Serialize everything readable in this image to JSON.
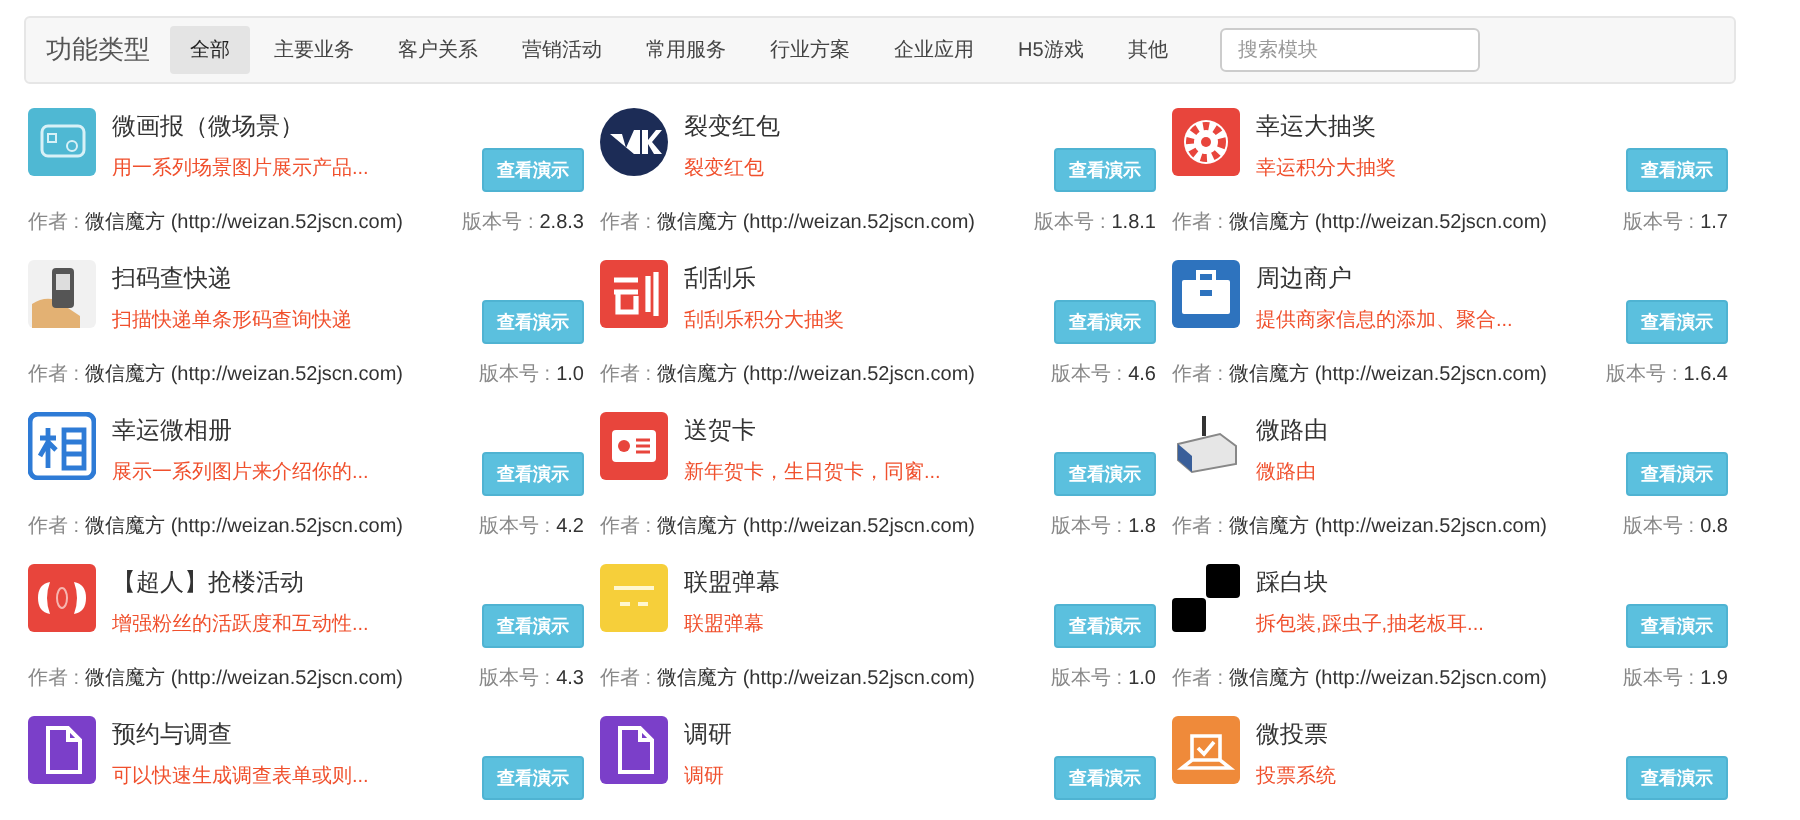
{
  "filter_bar": {
    "label": "功能类型",
    "tabs": [
      {
        "label": "全部",
        "selected": true
      },
      {
        "label": "主要业务",
        "selected": false
      },
      {
        "label": "客户关系",
        "selected": false
      },
      {
        "label": "营销活动",
        "selected": false
      },
      {
        "label": "常用服务",
        "selected": false
      },
      {
        "label": "行业方案",
        "selected": false
      },
      {
        "label": "企业应用",
        "selected": false
      },
      {
        "label": "H5游戏",
        "selected": false
      },
      {
        "label": "其他",
        "selected": false
      }
    ],
    "search": {
      "placeholder": "搜索模块"
    }
  },
  "modules": [
    {
      "title": "微画报（微场景）",
      "description": "用一系列场景图片展示产品...",
      "button": "查看演示",
      "author_label": "作者 :",
      "author": "微信魔方 (http://weizan.52jscn.com)",
      "version_label": "版本号 :",
      "version": "2.8.3"
    },
    {
      "title": "裂变红包",
      "description": "裂变红包",
      "button": "查看演示",
      "author_label": "作者 :",
      "author": "微信魔方 (http://weizan.52jscn.com)",
      "version_label": "版本号 :",
      "version": "1.8.1"
    },
    {
      "title": "幸运大抽奖",
      "description": "幸运积分大抽奖",
      "button": "查看演示",
      "author_label": "作者 :",
      "author": "微信魔方 (http://weizan.52jscn.com)",
      "version_label": "版本号 :",
      "version": "1.7"
    },
    {
      "title": "扫码查快递",
      "description": "扫描快递单条形码查询快递",
      "button": "查看演示",
      "author_label": "作者 :",
      "author": "微信魔方 (http://weizan.52jscn.com)",
      "version_label": "版本号 :",
      "version": "1.0"
    },
    {
      "title": "刮刮乐",
      "description": "刮刮乐积分大抽奖",
      "button": "查看演示",
      "author_label": "作者 :",
      "author": "微信魔方 (http://weizan.52jscn.com)",
      "version_label": "版本号 :",
      "version": "4.6"
    },
    {
      "title": "周边商户",
      "description": "提供商家信息的添加、聚合...",
      "button": "查看演示",
      "author_label": "作者 :",
      "author": "微信魔方 (http://weizan.52jscn.com)",
      "version_label": "版本号 :",
      "version": "1.6.4"
    },
    {
      "title": "幸运微相册",
      "description": "展示一系列图片来介绍你的...",
      "button": "查看演示",
      "author_label": "作者 :",
      "author": "微信魔方 (http://weizan.52jscn.com)",
      "version_label": "版本号 :",
      "version": "4.2"
    },
    {
      "title": "送贺卡",
      "description": "新年贺卡，生日贺卡，同窗...",
      "button": "查看演示",
      "author_label": "作者 :",
      "author": "微信魔方 (http://weizan.52jscn.com)",
      "version_label": "版本号 :",
      "version": "1.8"
    },
    {
      "title": "微路由",
      "description": "微路由",
      "button": "查看演示",
      "author_label": "作者 :",
      "author": "微信魔方 (http://weizan.52jscn.com)",
      "version_label": "版本号 :",
      "version": "0.8"
    },
    {
      "title": "【超人】抢楼活动",
      "description": "增强粉丝的活跃度和互动性...",
      "button": "查看演示",
      "author_label": "作者 :",
      "author": "微信魔方 (http://weizan.52jscn.com)",
      "version_label": "版本号 :",
      "version": "4.3"
    },
    {
      "title": "联盟弹幕",
      "description": "联盟弹幕",
      "button": "查看演示",
      "author_label": "作者 :",
      "author": "微信魔方 (http://weizan.52jscn.com)",
      "version_label": "版本号 :",
      "version": "1.0"
    },
    {
      "title": "踩白块",
      "description": "拆包装,踩虫子,抽老板耳...",
      "button": "查看演示",
      "author_label": "作者 :",
      "author": "微信魔方 (http://weizan.52jscn.com)",
      "version_label": "版本号 :",
      "version": "1.9"
    },
    {
      "title": "预约与调查",
      "description": "可以快速生成调查表单或则...",
      "button": "查看演示"
    },
    {
      "title": "调研",
      "description": "调研",
      "button": "查看演示"
    },
    {
      "title": "微投票",
      "description": "投票系统",
      "button": "查看演示"
    }
  ]
}
